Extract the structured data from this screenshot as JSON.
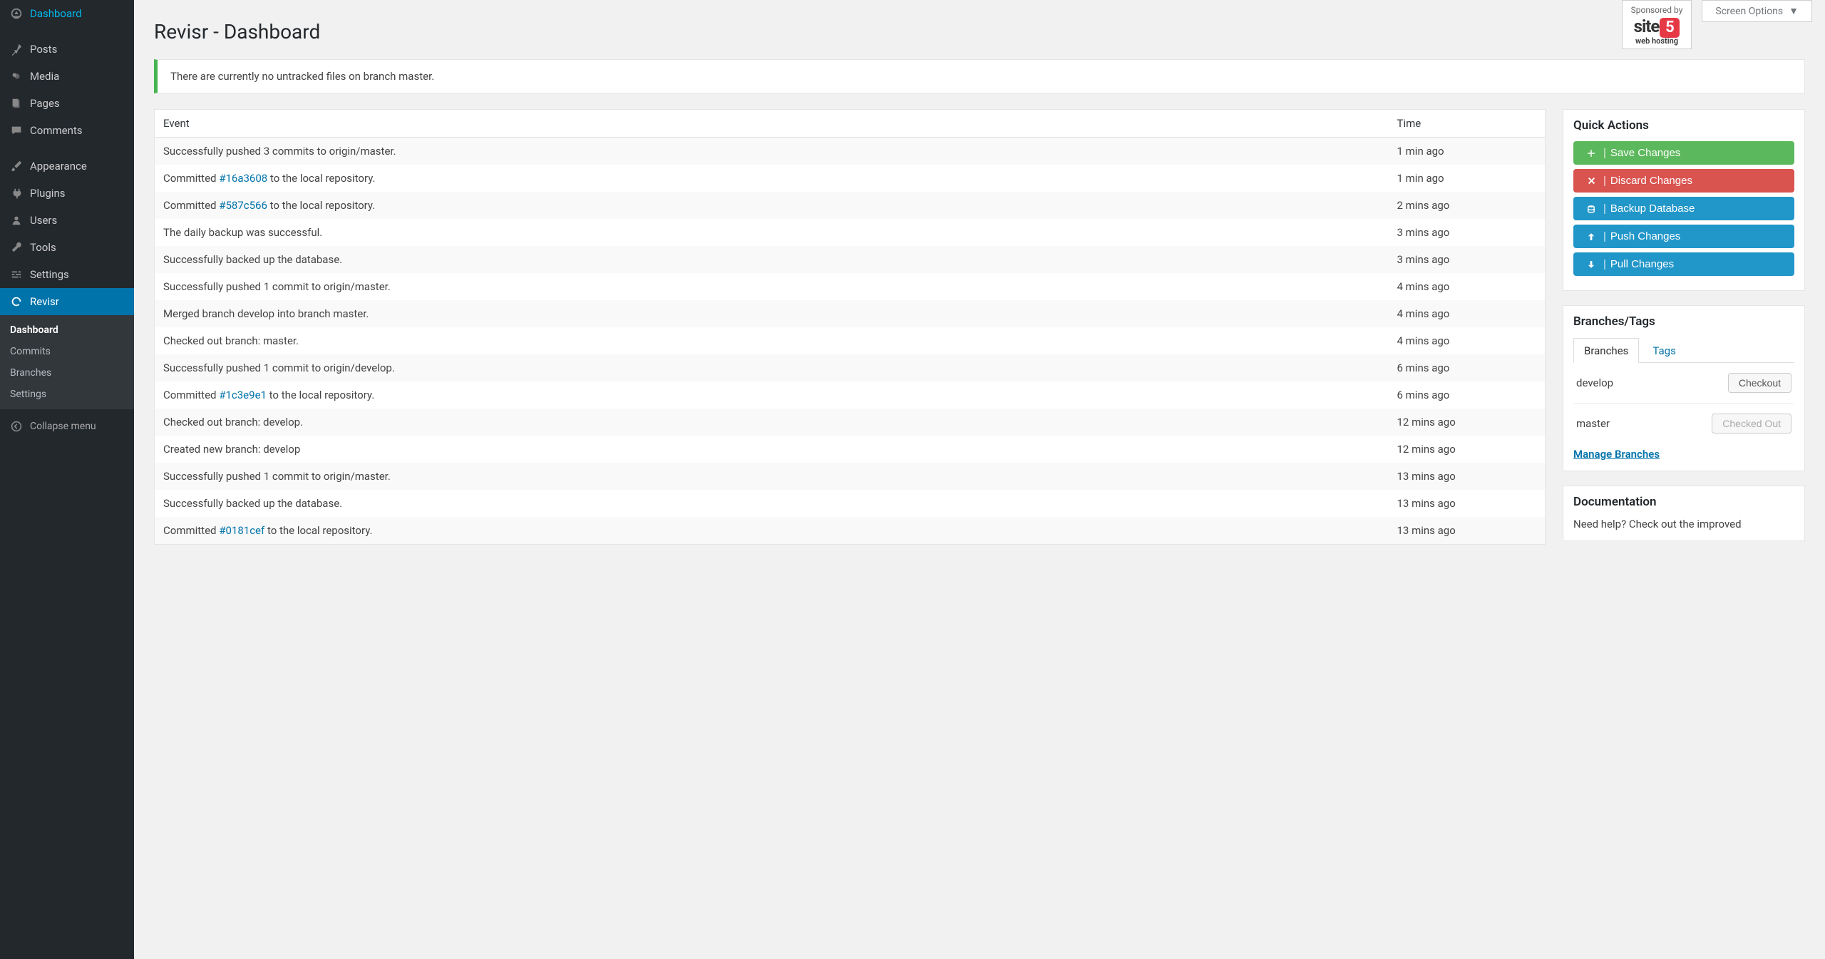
{
  "sidebar": {
    "items": [
      {
        "label": "Dashboard"
      },
      {
        "label": "Posts"
      },
      {
        "label": "Media"
      },
      {
        "label": "Pages"
      },
      {
        "label": "Comments"
      },
      {
        "label": "Appearance"
      },
      {
        "label": "Plugins"
      },
      {
        "label": "Users"
      },
      {
        "label": "Tools"
      },
      {
        "label": "Settings"
      },
      {
        "label": "Revisr"
      }
    ],
    "submenu": [
      {
        "label": "Dashboard"
      },
      {
        "label": "Commits"
      },
      {
        "label": "Branches"
      },
      {
        "label": "Settings"
      }
    ],
    "collapse": "Collapse menu"
  },
  "header": {
    "title": "Revisr - Dashboard",
    "sponsored_label": "Sponsored by",
    "sponsor_name": "site",
    "sponsor_five": "5",
    "sponsor_sub": "web hosting",
    "screen_options": "Screen Options"
  },
  "notice": {
    "text": "There are currently no untracked files on branch master."
  },
  "table": {
    "headers": {
      "event": "Event",
      "time": "Time"
    },
    "rows": [
      {
        "prefix": "Successfully pushed 3 commits to origin/master.",
        "link": "",
        "suffix": "",
        "time": "1 min ago"
      },
      {
        "prefix": "Committed ",
        "link": "#16a3608",
        "suffix": " to the local repository.",
        "time": "1 min ago"
      },
      {
        "prefix": "Committed ",
        "link": "#587c566",
        "suffix": " to the local repository.",
        "time": "2 mins ago"
      },
      {
        "prefix": "The daily backup was successful.",
        "link": "",
        "suffix": "",
        "time": "3 mins ago"
      },
      {
        "prefix": "Successfully backed up the database.",
        "link": "",
        "suffix": "",
        "time": "3 mins ago"
      },
      {
        "prefix": "Successfully pushed 1 commit to origin/master.",
        "link": "",
        "suffix": "",
        "time": "4 mins ago"
      },
      {
        "prefix": "Merged branch develop into branch master.",
        "link": "",
        "suffix": "",
        "time": "4 mins ago"
      },
      {
        "prefix": "Checked out branch: master.",
        "link": "",
        "suffix": "",
        "time": "4 mins ago"
      },
      {
        "prefix": "Successfully pushed 1 commit to origin/develop.",
        "link": "",
        "suffix": "",
        "time": "6 mins ago"
      },
      {
        "prefix": "Committed ",
        "link": "#1c3e9e1",
        "suffix": " to the local repository.",
        "time": "6 mins ago"
      },
      {
        "prefix": "Checked out branch: develop.",
        "link": "",
        "suffix": "",
        "time": "12 mins ago"
      },
      {
        "prefix": "Created new branch: develop",
        "link": "",
        "suffix": "",
        "time": "12 mins ago"
      },
      {
        "prefix": "Successfully pushed 1 commit to origin/master.",
        "link": "",
        "suffix": "",
        "time": "13 mins ago"
      },
      {
        "prefix": "Successfully backed up the database.",
        "link": "",
        "suffix": "",
        "time": "13 mins ago"
      },
      {
        "prefix": "Committed ",
        "link": "#0181cef",
        "suffix": " to the local repository.",
        "time": "13 mins ago"
      }
    ]
  },
  "quick_actions": {
    "title": "Quick Actions",
    "buttons": [
      {
        "label": "Save Changes",
        "class": "btn-green",
        "icon": "plus"
      },
      {
        "label": "Discard Changes",
        "class": "btn-red",
        "icon": "x"
      },
      {
        "label": "Backup Database",
        "class": "btn-blue",
        "icon": "db"
      },
      {
        "label": "Push Changes",
        "class": "btn-blue",
        "icon": "up"
      },
      {
        "label": "Pull Changes",
        "class": "btn-blue",
        "icon": "down"
      }
    ]
  },
  "branches": {
    "title": "Branches/Tags",
    "tabs": {
      "branches": "Branches",
      "tags": "Tags"
    },
    "rows": [
      {
        "name": "develop",
        "button": "Checkout",
        "disabled": false
      },
      {
        "name": "master",
        "button": "Checked Out",
        "disabled": true
      }
    ],
    "manage": "Manage Branches"
  },
  "documentation": {
    "title": "Documentation",
    "text": "Need help? Check out the improved"
  }
}
